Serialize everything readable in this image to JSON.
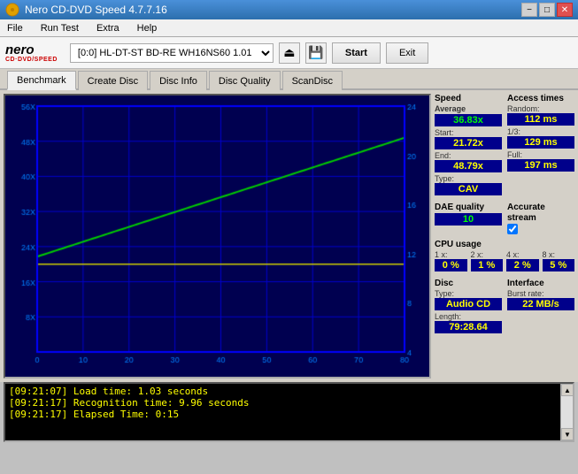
{
  "window": {
    "title": "Nero CD-DVD Speed 4.7.7.16",
    "icon": "disc-icon"
  },
  "titlebar": {
    "minimize_label": "−",
    "maximize_label": "□",
    "close_label": "✕"
  },
  "menu": {
    "items": [
      "File",
      "Run Test",
      "Extra",
      "Help"
    ]
  },
  "toolbar": {
    "logo_top": "nero",
    "logo_bottom": "CD·DVD/SPEED",
    "drive_value": "[0:0]  HL-DT-ST BD-RE  WH16NS60 1.01",
    "start_label": "Start",
    "exit_label": "Exit"
  },
  "tabs": [
    {
      "label": "Benchmark",
      "active": true
    },
    {
      "label": "Create Disc",
      "active": false
    },
    {
      "label": "Disc Info",
      "active": false
    },
    {
      "label": "Disc Quality",
      "active": false
    },
    {
      "label": "ScanDisc",
      "active": false
    }
  ],
  "chart": {
    "x_labels": [
      "0",
      "10",
      "20",
      "30",
      "40",
      "50",
      "60",
      "70",
      "80"
    ],
    "y_labels_left": [
      "56 X",
      "48 X",
      "40 X",
      "32 X",
      "24 X",
      "16 X",
      "8 X"
    ],
    "y_labels_right": [
      "24",
      "20",
      "16",
      "12",
      "8",
      "4"
    ]
  },
  "right_panel": {
    "speed_section": {
      "title": "Speed",
      "average_label": "Average",
      "average_value": "36.83x",
      "start_label": "Start:",
      "start_value": "21.72x",
      "end_label": "End:",
      "end_value": "48.79x",
      "type_label": "Type:",
      "type_value": "CAV"
    },
    "access_section": {
      "title": "Access times",
      "random_label": "Random:",
      "random_value": "112 ms",
      "one_third_label": "1/3:",
      "one_third_value": "129 ms",
      "full_label": "Full:",
      "full_value": "197 ms"
    },
    "dae_section": {
      "title": "DAE quality",
      "value": "10"
    },
    "accurate_stream": {
      "title": "Accurate",
      "subtitle": "stream",
      "checked": true
    },
    "cpu_section": {
      "title": "CPU usage",
      "x1_label": "1 x:",
      "x1_value": "0 %",
      "x2_label": "2 x:",
      "x2_value": "1 %",
      "x4_label": "4 x:",
      "x4_value": "2 %",
      "x8_label": "8 x:",
      "x8_value": "5 %"
    },
    "disc_section": {
      "title": "Disc",
      "type_label": "Type:",
      "type_value": "Audio CD",
      "length_label": "Length:",
      "length_value": "79:28.64"
    },
    "interface_section": {
      "title": "Interface",
      "burst_label": "Burst rate:",
      "burst_value": "22 MB/s"
    }
  },
  "log": {
    "lines": [
      {
        "time": "[09:21:07]",
        "text": "Load time: 1.03 seconds",
        "color": "yellow"
      },
      {
        "time": "[09:21:17]",
        "text": "Recognition time: 9.96 seconds",
        "color": "yellow"
      },
      {
        "time": "[09:21:17]",
        "text": "Elapsed Time: 0:15",
        "color": "yellow"
      }
    ]
  }
}
